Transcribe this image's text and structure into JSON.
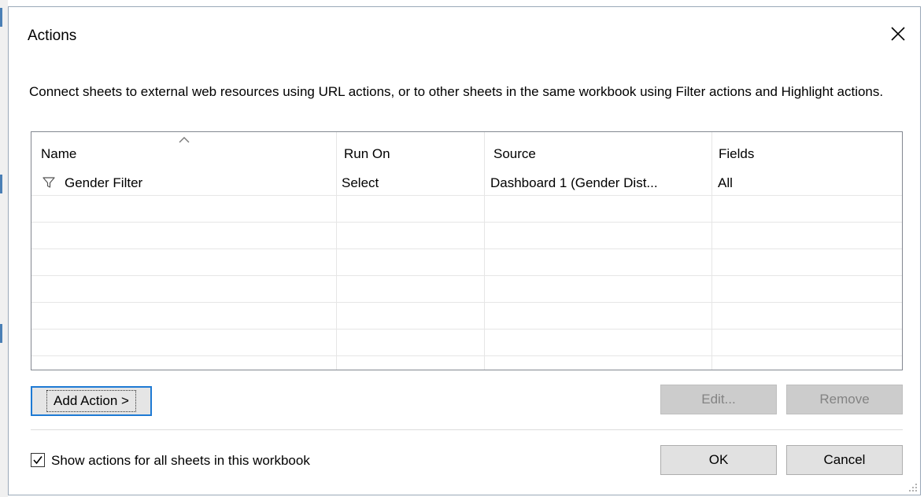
{
  "dialog": {
    "title": "Actions",
    "description": "Connect sheets to external web resources using URL actions, or to other sheets in the same workbook using Filter actions and Highlight actions."
  },
  "table": {
    "columns": [
      "Name",
      "Run On",
      "Source",
      "Fields"
    ],
    "rows": [
      {
        "icon": "filter-icon",
        "name": "Gender Filter",
        "run_on": "Select",
        "source": "Dashboard 1 (Gender Dist...",
        "fields": "All"
      }
    ],
    "sort_column": "Name",
    "sort_direction": "ascending"
  },
  "buttons": {
    "add_action": "Add Action >",
    "edit": "Edit...",
    "remove": "Remove",
    "ok": "OK",
    "cancel": "Cancel"
  },
  "show_all_sheets": {
    "label": "Show actions for all sheets in this workbook",
    "checked": true
  },
  "colors": {
    "focus_border": "#1e7ad4",
    "disabled_text": "#838383"
  }
}
